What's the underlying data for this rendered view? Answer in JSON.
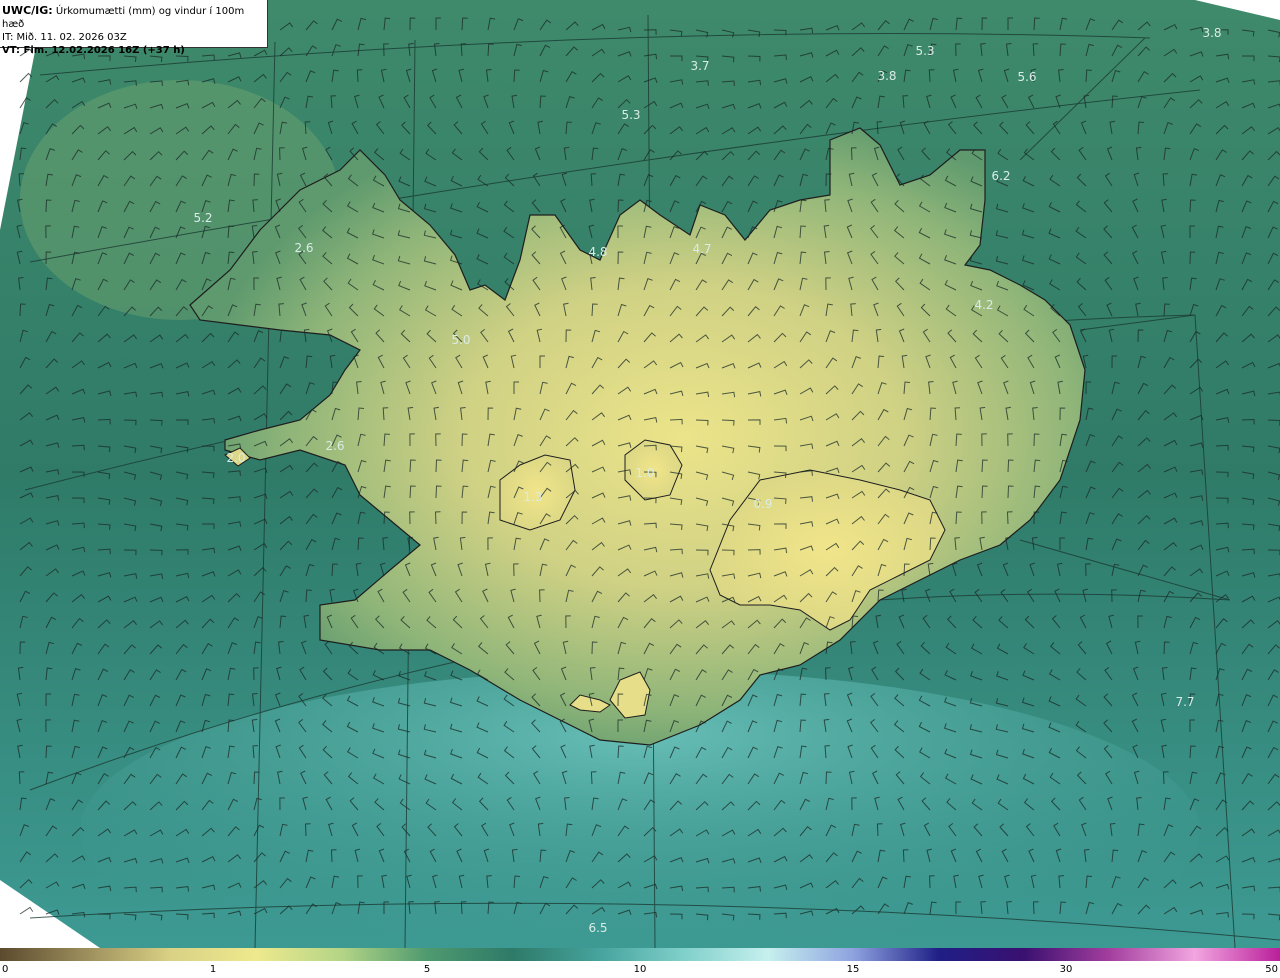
{
  "header": {
    "prefix": "UWC/IG:",
    "title": "Úrkomumætti (mm) og vindur í 100m hæð",
    "it_line": "IT: Mið. 11. 02. 2026 03Z",
    "vt_line": "VT: Fim. 12.02.2026 16Z (+37 h)"
  },
  "map_values": [
    {
      "text": "3.7"
    },
    {
      "text": "5.3"
    },
    {
      "text": "3.8"
    },
    {
      "text": "5.6"
    },
    {
      "text": "3.8"
    },
    {
      "text": "5.3"
    },
    {
      "text": "6.2"
    },
    {
      "text": "5.2"
    },
    {
      "text": "2.6"
    },
    {
      "text": "4.8"
    },
    {
      "text": "4.7"
    },
    {
      "text": "5.0"
    },
    {
      "text": "4.2"
    },
    {
      "text": "2.6"
    },
    {
      "text": "2.0"
    },
    {
      "text": "1.0"
    },
    {
      "text": "1.3"
    },
    {
      "text": "0.9"
    },
    {
      "text": "7.7"
    },
    {
      "text": "6.5"
    }
  ],
  "colorbar": {
    "ticks": [
      "0",
      "1",
      "5",
      "10",
      "15",
      "30",
      "50"
    ],
    "colors": [
      "#5b4a2e",
      "#9c8e5c",
      "#d9d184",
      "#eee98e",
      "#b4d586",
      "#4f9a6f",
      "#2e7a68",
      "#45a29c",
      "#7fcfca",
      "#c6f0ee",
      "#8ea2e0",
      "#1f1f86",
      "#3a1070",
      "#a33e9e",
      "#f2a5e0",
      "#b91f9a"
    ]
  },
  "colors": {
    "sea": "#2a7566",
    "land_high": "#e8e088",
    "land_mid": "#b6c67e",
    "coast": "#1e1e1e"
  }
}
